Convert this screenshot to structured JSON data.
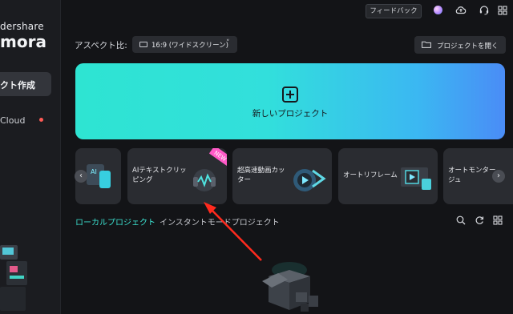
{
  "sidebar": {
    "brand_top": "dershare",
    "brand_main": "mora",
    "active_item": "クト作成",
    "cloud_item": "Cloud"
  },
  "topbar": {
    "feedback_label": "フィードバック",
    "icons": [
      "avatar",
      "cloud-upload-icon",
      "headset-icon",
      "grid-icon"
    ]
  },
  "aspect": {
    "label": "アスペクト比:",
    "value": "16:9 (ワイドスクリーン)",
    "chevron": "˅"
  },
  "open_project_label": "プロジェクトを開く",
  "new_project_label": "新しいプロジェクト",
  "cards": [
    {
      "label": "",
      "icon": "ai-card"
    },
    {
      "label": "AIテキストクリッ\nピング",
      "icon": "ai-text-clipping",
      "badge": "NEW"
    },
    {
      "label": "超高速動画カッ\nター",
      "icon": "video-cutter"
    },
    {
      "label": "オートリフレーム",
      "icon": "auto-reframe"
    },
    {
      "label": "オートモンター\nジュ",
      "icon": "auto-montage"
    }
  ],
  "tabs": {
    "local": "ローカルプロジェクト",
    "instant": "インスタントモードプロジェクト"
  },
  "colors": {
    "accent": "#3be0cf",
    "background": "#131417",
    "arrow": "#ff2a1e"
  }
}
